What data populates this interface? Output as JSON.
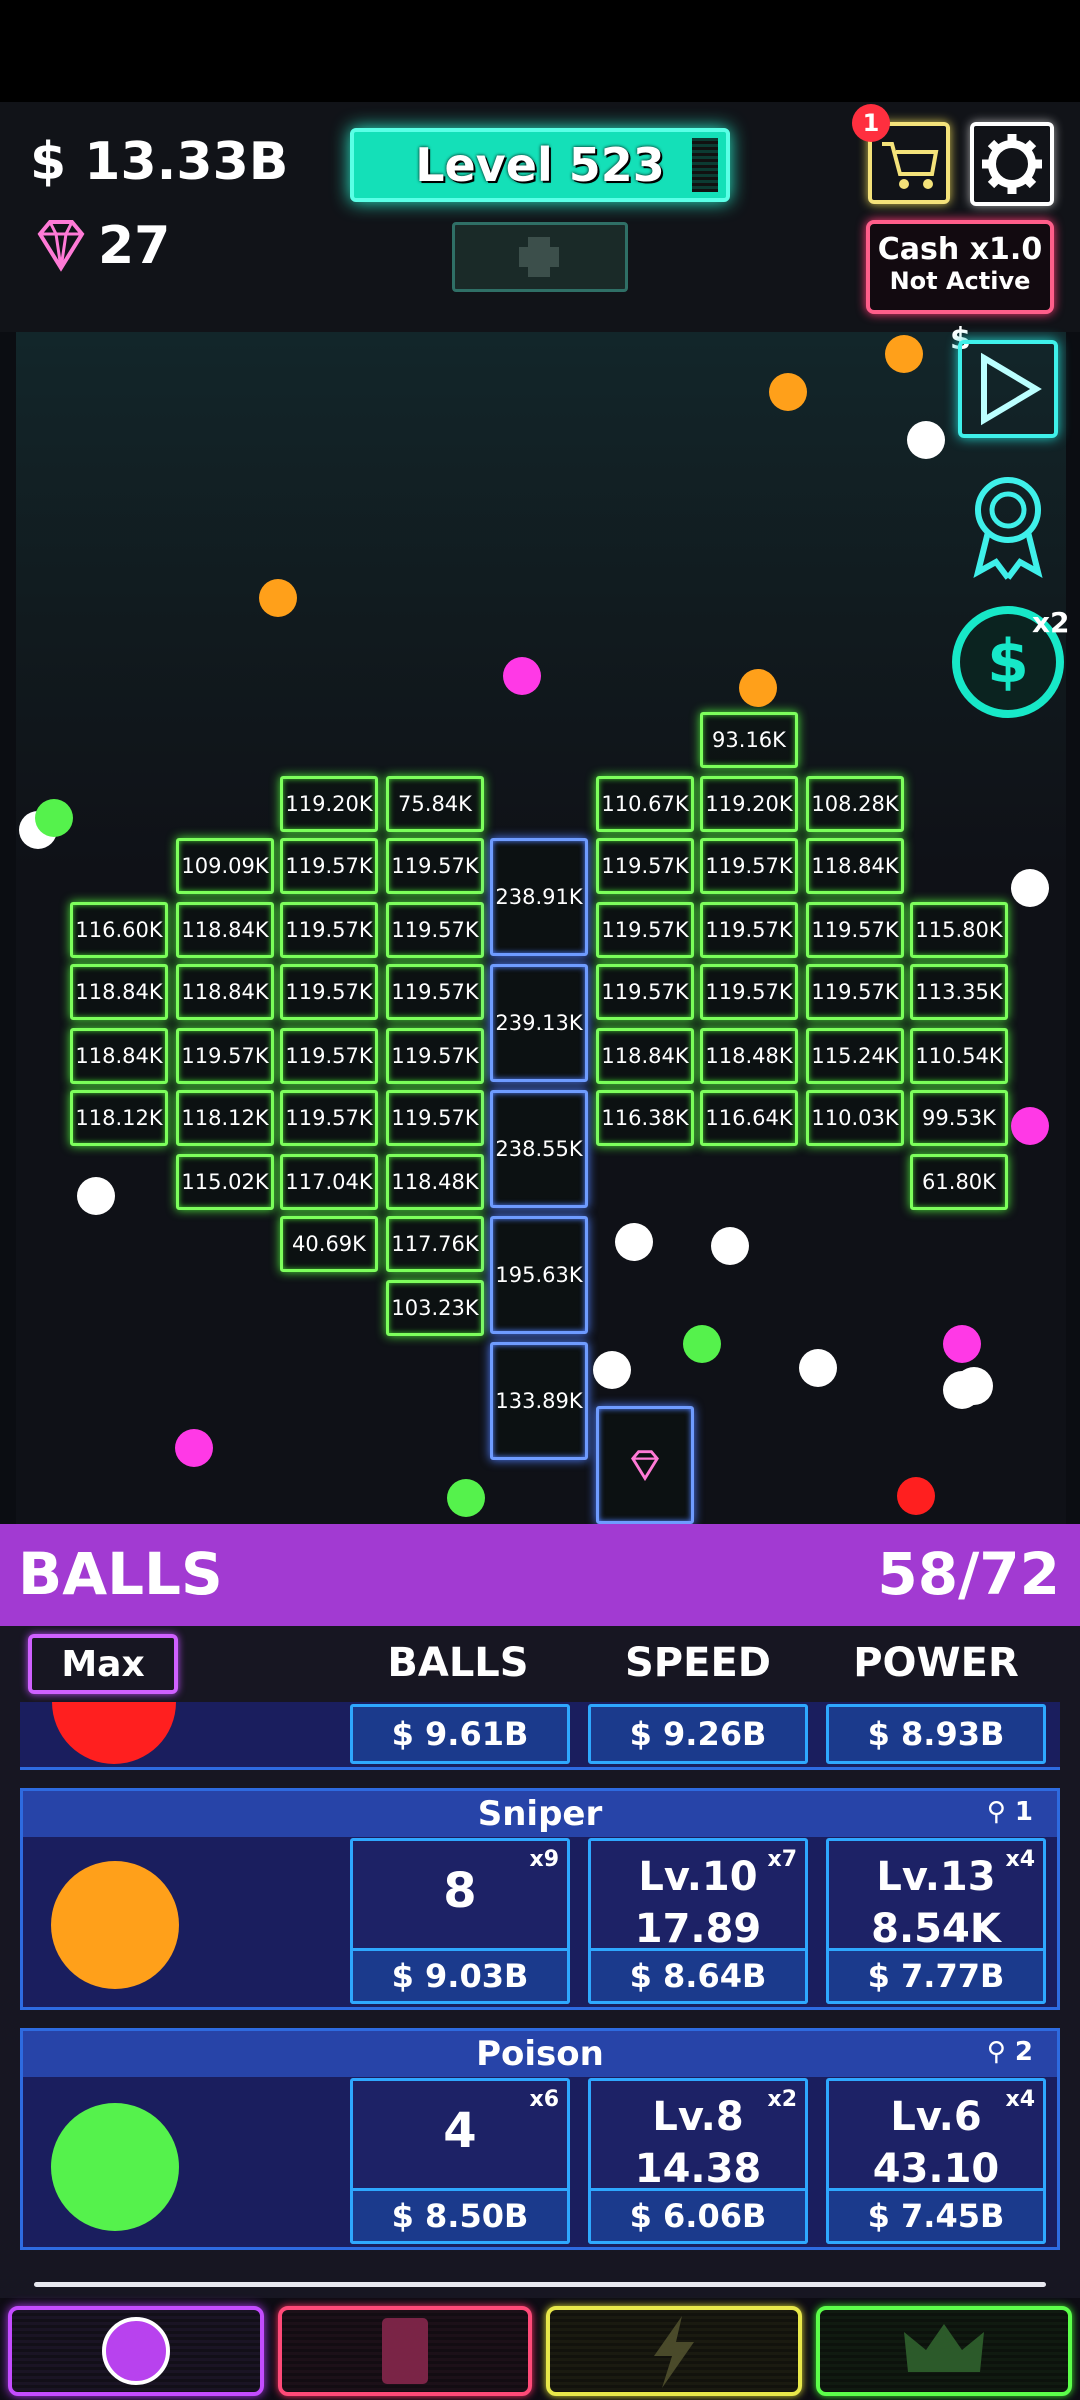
{
  "header": {
    "money": "$ 13.33B",
    "gems": "27",
    "level_label": "Level 523",
    "cart_badge": "1",
    "cash_title": "Cash x1.0",
    "cash_status": "Not Active"
  },
  "side_buttons": {
    "video_dollar": "$",
    "cash_multiplier": "x2"
  },
  "bricks_green": [
    {
      "label": "93.16K"
    },
    {
      "label": "119.20K"
    },
    {
      "label": "75.84K"
    },
    {
      "label": "110.67K"
    },
    {
      "label": "119.20K"
    },
    {
      "label": "108.28K"
    },
    {
      "label": "109.09K"
    },
    {
      "label": "119.57K"
    },
    {
      "label": "119.57K"
    },
    {
      "label": "119.57K"
    },
    {
      "label": "119.57K"
    },
    {
      "label": "118.84K"
    },
    {
      "label": "116.60K"
    },
    {
      "label": "118.84K"
    },
    {
      "label": "119.57K"
    },
    {
      "label": "119.57K"
    },
    {
      "label": "119.57K"
    },
    {
      "label": "119.57K"
    },
    {
      "label": "119.57K"
    },
    {
      "label": "115.80K"
    },
    {
      "label": "118.84K"
    },
    {
      "label": "118.84K"
    },
    {
      "label": "119.57K"
    },
    {
      "label": "119.57K"
    },
    {
      "label": "119.57K"
    },
    {
      "label": "119.57K"
    },
    {
      "label": "119.57K"
    },
    {
      "label": "113.35K"
    },
    {
      "label": "118.84K"
    },
    {
      "label": "119.57K"
    },
    {
      "label": "119.57K"
    },
    {
      "label": "119.57K"
    },
    {
      "label": "118.84K"
    },
    {
      "label": "118.48K"
    },
    {
      "label": "115.24K"
    },
    {
      "label": "110.54K"
    },
    {
      "label": "118.12K"
    },
    {
      "label": "118.12K"
    },
    {
      "label": "119.57K"
    },
    {
      "label": "119.57K"
    },
    {
      "label": "116.38K"
    },
    {
      "label": "116.64K"
    },
    {
      "label": "110.03K"
    },
    {
      "label": "99.53K"
    },
    {
      "label": "115.02K"
    },
    {
      "label": "117.04K"
    },
    {
      "label": "118.48K"
    },
    {
      "label": "61.80K"
    },
    {
      "label": "40.69K"
    },
    {
      "label": "117.76K"
    },
    {
      "label": "103.23K"
    }
  ],
  "bricks_blue": [
    {
      "label": "238.91K"
    },
    {
      "label": "239.13K"
    },
    {
      "label": "238.55K"
    },
    {
      "label": "195.63K"
    },
    {
      "label": "133.89K"
    }
  ],
  "balls_section": {
    "title": "BALLS",
    "count": "58/72",
    "max_label": "Max",
    "columns": [
      "BALLS",
      "SPEED",
      "POWER"
    ]
  },
  "ball_types": [
    {
      "name": "",
      "color": "#ff1f1f",
      "prices": [
        "$ 9.61B",
        "$ 9.26B",
        "$ 8.93B"
      ]
    },
    {
      "name": "Sniper",
      "color": "#ffa01a",
      "trophy": "1",
      "balls": {
        "value": "8",
        "mult": "x9",
        "price": "$ 9.03B"
      },
      "speed": {
        "level": "Lv.10",
        "value": "17.89",
        "mult": "x7",
        "price": "$ 8.64B"
      },
      "power": {
        "level": "Lv.13",
        "value": "8.54K",
        "mult": "x4",
        "price": "$ 7.77B"
      }
    },
    {
      "name": "Poison",
      "color": "#55f24c",
      "trophy": "2",
      "balls": {
        "value": "4",
        "mult": "x6",
        "price": "$ 8.50B"
      },
      "speed": {
        "level": "Lv.8",
        "value": "14.38",
        "mult": "x2",
        "price": "$ 6.06B"
      },
      "power": {
        "level": "Lv.6",
        "value": "43.10",
        "mult": "x4",
        "price": "$ 7.45B"
      }
    }
  ],
  "nav_tabs": [
    {
      "icon": "ball-icon",
      "color": "#c44cff"
    },
    {
      "icon": "card-icon",
      "color": "#ff4a78"
    },
    {
      "icon": "lightning-icon",
      "color": "#e8e84a"
    },
    {
      "icon": "crown-icon",
      "color": "#5cff4a"
    }
  ]
}
